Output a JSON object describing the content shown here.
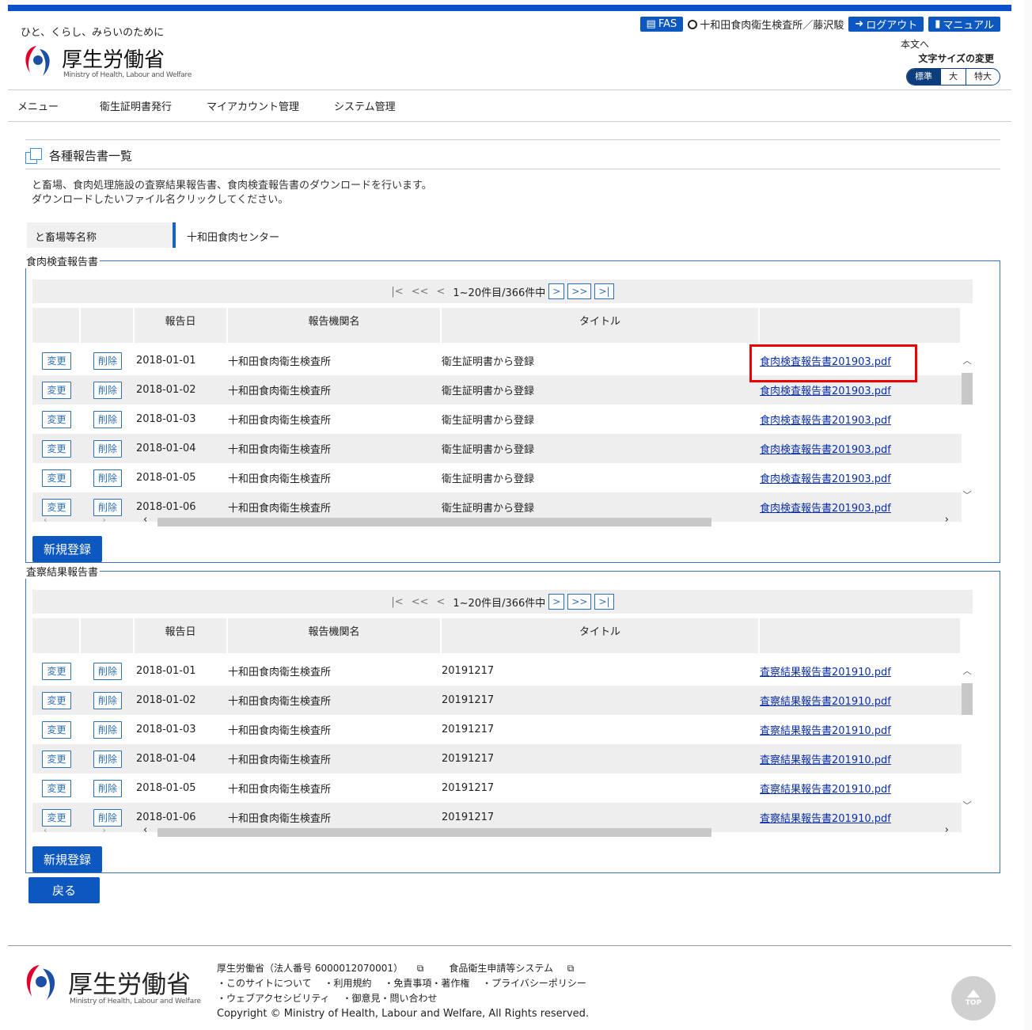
{
  "header": {
    "tagline": "ひと、くらし、みらいのために",
    "ministry_name": "厚生労働省",
    "ministry_en": "Ministry of Health, Labour and Welfare",
    "fas_label": "FAS",
    "user_label": "十和田食肉衛生検査所／藤沢駿",
    "logout_label": "ログアウト",
    "manual_label": "マニュアル",
    "jump_to_main": "本文へ",
    "font_size_label": "文字サイズの変更",
    "font_sizes": [
      "標準",
      "大",
      "特大"
    ]
  },
  "nav": {
    "items": [
      "メニュー",
      "衛生証明書発行",
      "マイアカウント管理",
      "システム管理"
    ]
  },
  "page": {
    "title": "各種報告書一覧",
    "desc_line1": "と畜場、食肉処理施設の査察結果報告書、食肉検査報告書のダウンロードを行います。",
    "desc_line2": "ダウンロードしたいファイル名クリックしてください。",
    "facility_label": "と畜場等名称",
    "facility_value": "十和田食肉センター",
    "back_label": "戻る"
  },
  "sections": [
    {
      "legend": "食肉検査報告書",
      "pager": {
        "first": "|<",
        "prev_page": "<<",
        "prev": "<",
        "count": "1~20件目/366件中",
        "next": ">",
        "next_page": ">>",
        "last": ">|"
      },
      "columns": [
        "報告日",
        "報告機関名",
        "タイトル"
      ],
      "rows": [
        {
          "date": "2018-01-01",
          "org": "十和田食肉衛生検査所",
          "title": "衛生証明書から登録",
          "file": "食肉検査報告書201903.pdf"
        },
        {
          "date": "2018-01-02",
          "org": "十和田食肉衛生検査所",
          "title": "衛生証明書から登録",
          "file": "食肉検査報告書201903.pdf"
        },
        {
          "date": "2018-01-03",
          "org": "十和田食肉衛生検査所",
          "title": "衛生証明書から登録",
          "file": "食肉検査報告書201903.pdf"
        },
        {
          "date": "2018-01-04",
          "org": "十和田食肉衛生検査所",
          "title": "衛生証明書から登録",
          "file": "食肉検査報告書201903.pdf"
        },
        {
          "date": "2018-01-05",
          "org": "十和田食肉衛生検査所",
          "title": "衛生証明書から登録",
          "file": "食肉検査報告書201903.pdf"
        },
        {
          "date": "2018-01-06",
          "org": "十和田食肉衛生検査所",
          "title": "衛生証明書から登録",
          "file": "食肉検査報告書201903.pdf"
        }
      ],
      "edit_label": "変更",
      "delete_label": "削除",
      "new_label": "新規登録"
    },
    {
      "legend": "査察結果報告書",
      "pager": {
        "first": "|<",
        "prev_page": "<<",
        "prev": "<",
        "count": "1~20件目/366件中",
        "next": ">",
        "next_page": ">>",
        "last": ">|"
      },
      "columns": [
        "報告日",
        "報告機関名",
        "タイトル"
      ],
      "rows": [
        {
          "date": "2018-01-01",
          "org": "十和田食肉衛生検査所",
          "title": "20191217",
          "file": "査察結果報告書201910.pdf"
        },
        {
          "date": "2018-01-02",
          "org": "十和田食肉衛生検査所",
          "title": "20191217",
          "file": "査察結果報告書201910.pdf"
        },
        {
          "date": "2018-01-03",
          "org": "十和田食肉衛生検査所",
          "title": "20191217",
          "file": "査察結果報告書201910.pdf"
        },
        {
          "date": "2018-01-04",
          "org": "十和田食肉衛生検査所",
          "title": "20191217",
          "file": "査察結果報告書201910.pdf"
        },
        {
          "date": "2018-01-05",
          "org": "十和田食肉衛生検査所",
          "title": "20191217",
          "file": "査察結果報告書201910.pdf"
        },
        {
          "date": "2018-01-06",
          "org": "十和田食肉衛生検査所",
          "title": "20191217",
          "file": "査察結果報告書201910.pdf"
        }
      ],
      "edit_label": "変更",
      "delete_label": "削除",
      "new_label": "新規登録"
    }
  ],
  "footer": {
    "ministry_name": "厚生労働省",
    "ministry_en": "Ministry of Health, Labour and Welfare",
    "corp_no": "厚生労働省（法人番号 6000012070001）",
    "system_name": "食品衛生申請等システム",
    "links_row1": [
      "・このサイトについて",
      "・利用規約",
      "・免責事項・著作権",
      "・プライバシーポリシー"
    ],
    "links_row2": [
      "・ウェブアクセシビリティ",
      "・御意見・問い合わせ"
    ],
    "copyright": "Copyright © Ministry of Health, Labour and Welfare, All Rights reserved.",
    "top_label": "TOP"
  },
  "colors": {
    "brand_blue": "#0d58c0",
    "highlight_red": "#ee0000",
    "link": "#0b2fa8"
  }
}
